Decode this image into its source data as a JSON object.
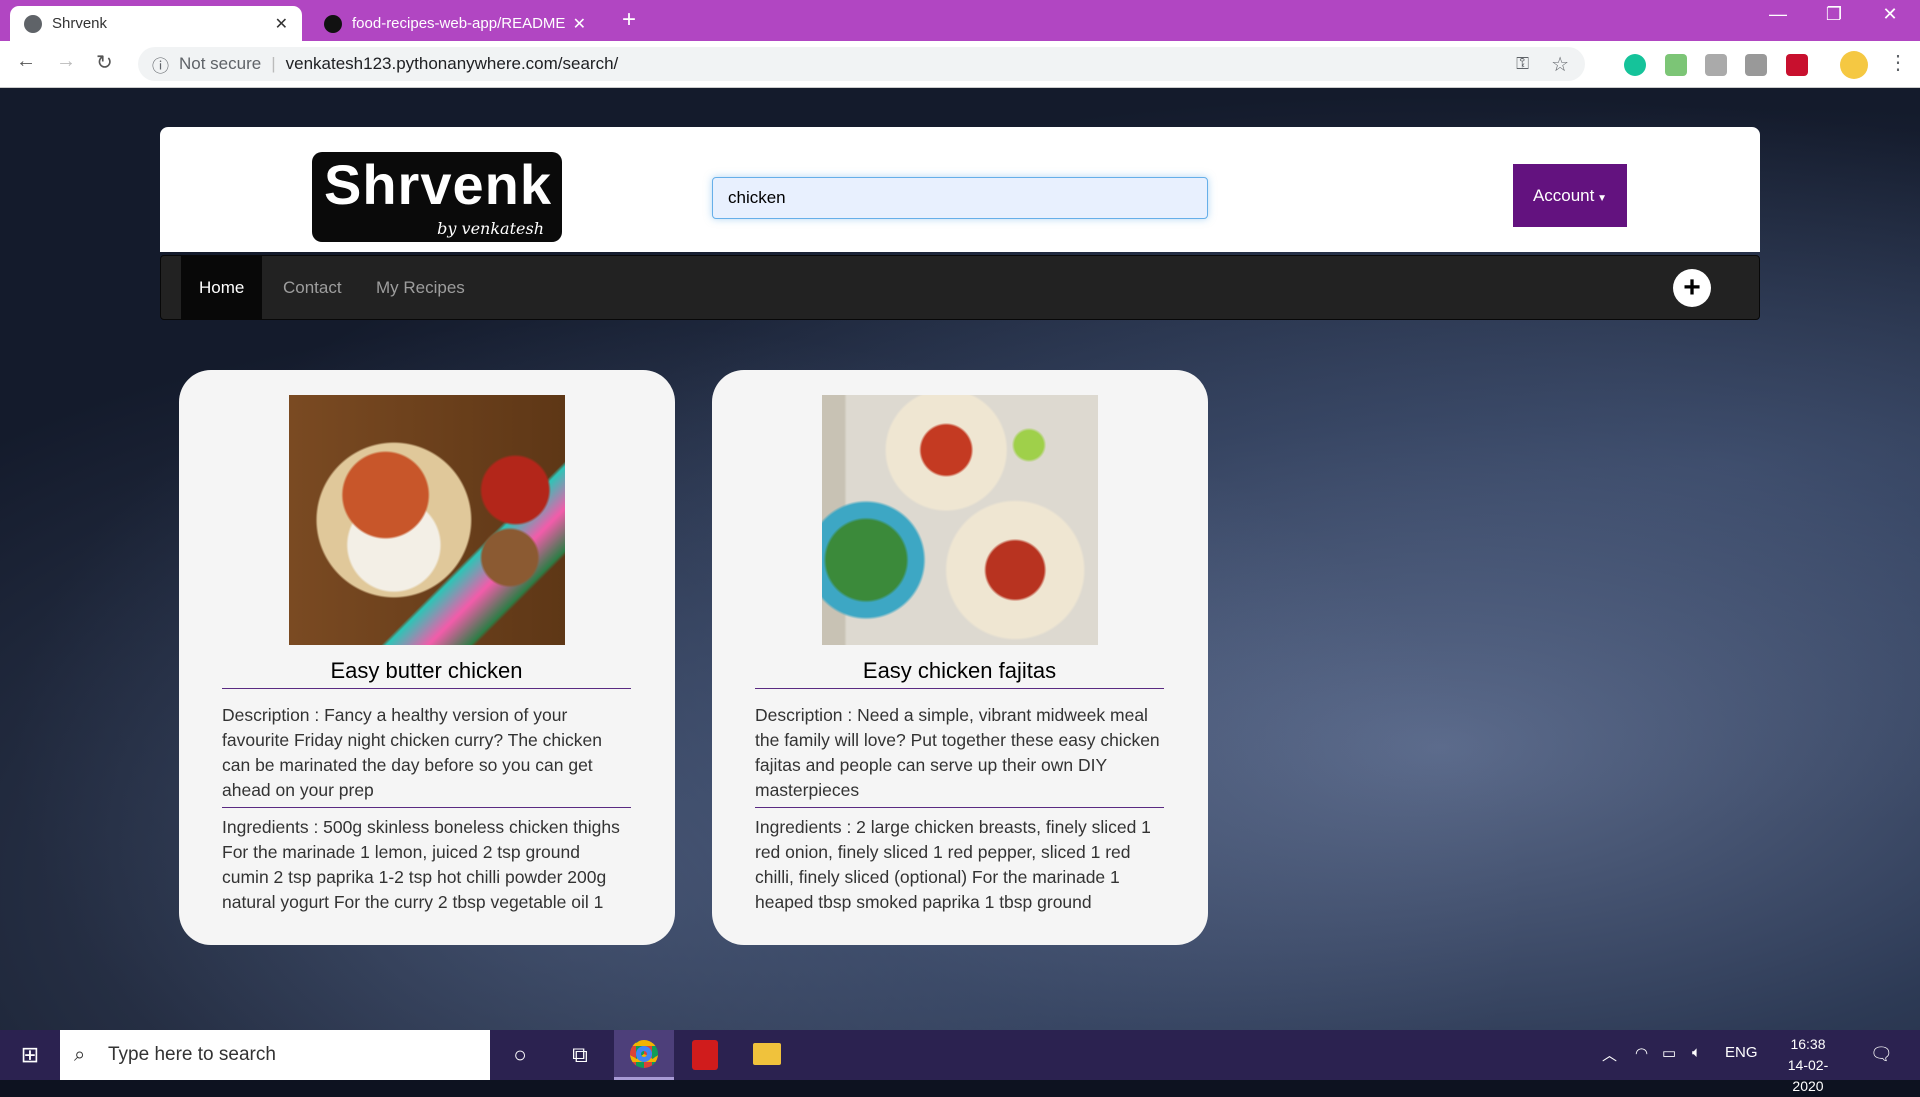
{
  "browser": {
    "tabs": [
      {
        "title": "Shrvenk",
        "icon": "globe-icon",
        "active": true
      },
      {
        "title": "food-recipes-web-app/README.md",
        "icon": "github-icon",
        "active": false
      }
    ],
    "security_label": "Not secure",
    "url": "venkatesh123.pythonanywhere.com/search/",
    "accent": "#b146c2"
  },
  "header": {
    "logo_title": "Shrvenk",
    "logo_subtitle": "by venkatesh",
    "search_value": "chicken",
    "account_label": "Account",
    "account_color": "#63127f"
  },
  "navbar": {
    "items": [
      "Home",
      "Contact",
      "My Recipes"
    ],
    "active": "Home",
    "add_icon": "plus-circle-icon"
  },
  "recipes": [
    {
      "title": "Easy butter chicken",
      "description": "Description : Fancy a healthy version of your favourite Friday night chicken curry? The chicken can be marinated the day before so you can get ahead on your prep",
      "ingredients": "Ingredients : 500g skinless boneless chicken thighs For the marinade 1 lemon, juiced 2 tsp ground cumin 2 tsp paprika 1-2 tsp hot chilli powder 200g natural yogurt For the curry 2 tbsp vegetable oil 1"
    },
    {
      "title": "Easy chicken fajitas",
      "description": "Description : Need a simple, vibrant midweek meal the family will love? Put together these easy chicken fajitas and people can serve up their own DIY masterpieces",
      "ingredients": "Ingredients : 2 large chicken breasts, finely sliced 1 red onion, finely sliced 1 red pepper, sliced 1 red chilli, finely sliced (optional) For the marinade 1 heaped tbsp smoked paprika 1 tbsp ground"
    }
  ],
  "taskbar": {
    "search_placeholder": "Type here to search",
    "language": "ENG",
    "time": "16:38",
    "date": "14-02-2020"
  }
}
